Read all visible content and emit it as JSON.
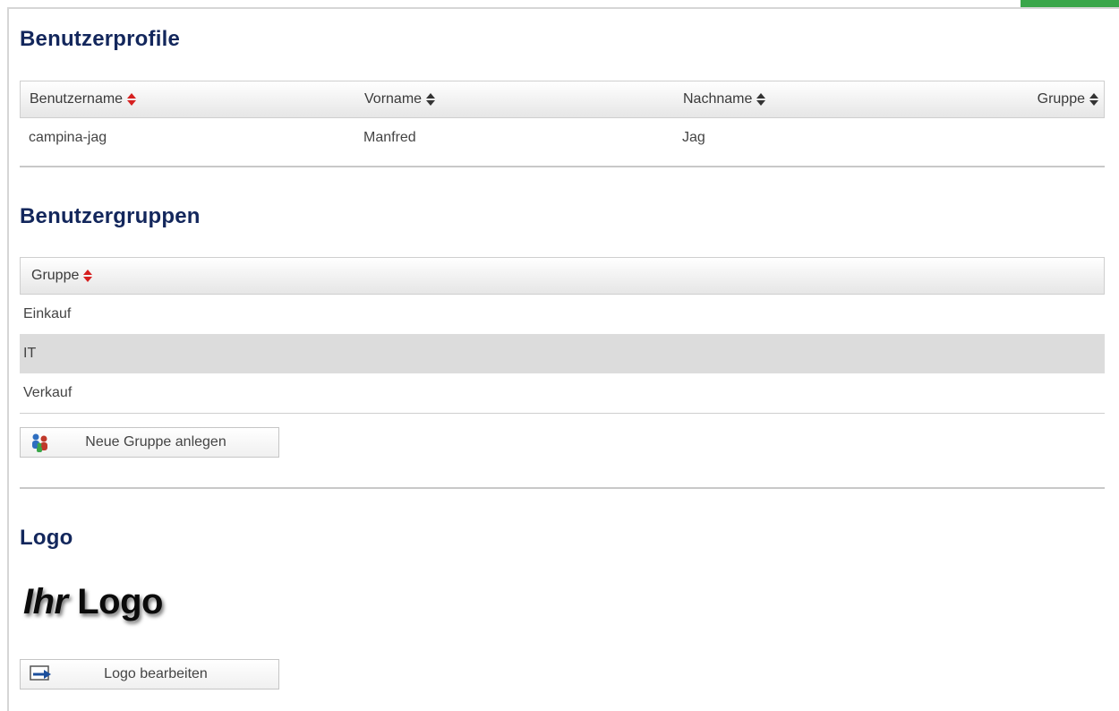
{
  "profiles": {
    "title": "Benutzerprofile",
    "columns": [
      "Benutzername",
      "Vorname",
      "Nachname",
      "Gruppe"
    ],
    "rows": [
      {
        "username": "campina-jag",
        "firstname": "Manfred",
        "lastname": "Jag",
        "group": ""
      }
    ]
  },
  "groups": {
    "title": "Benutzergruppen",
    "column": "Gruppe",
    "rows": [
      "Einkauf",
      "IT",
      "Verkauf"
    ],
    "new_button": "Neue Gruppe anlegen"
  },
  "logo": {
    "title": "Logo",
    "placeholder_word1": "Ihr",
    "placeholder_word2": "Logo",
    "edit_button": "Logo bearbeiten"
  },
  "colors": {
    "heading": "#13275c",
    "sort_active": "#d62020",
    "alt_row": "#dcdcdc",
    "accent": "#3aa64a"
  },
  "icons": {
    "new_group": "users-group-icon",
    "edit_logo": "edit-image-icon"
  }
}
